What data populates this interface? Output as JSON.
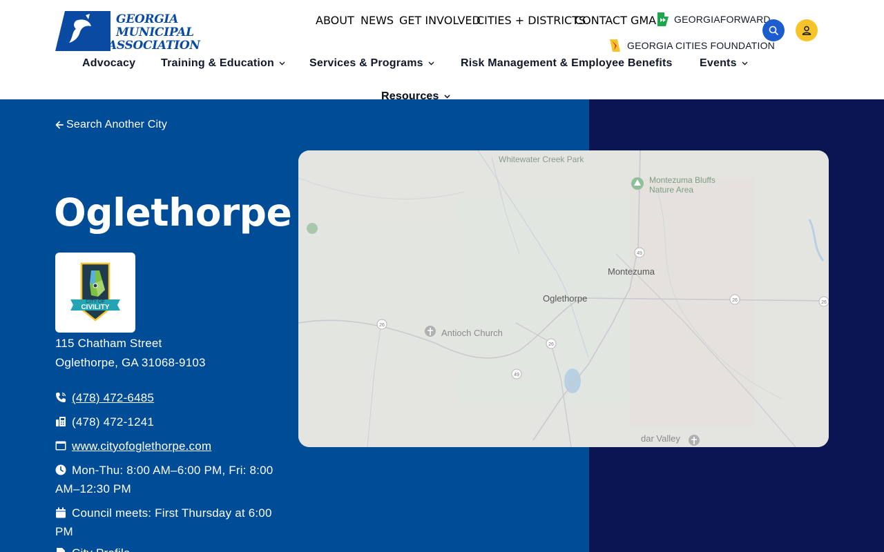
{
  "header": {
    "logo": {
      "line1": "GEORGIA",
      "line2": "MUNICIPAL",
      "line3": "ASSOCIATION"
    },
    "top_links": [
      "ABOUT",
      "NEWS",
      "GET INVOLVED",
      "CITIES + DISTRICTS",
      "CONTACT GMA"
    ],
    "georgia_forward": "GEORGIAFORWARD",
    "cities_foundation": "GEORGIA CITIES FOUNDATION",
    "search_icon": "search-icon",
    "user_icon": "user-icon",
    "main_nav": [
      {
        "label": "Advocacy",
        "dropdown": false
      },
      {
        "label": "Training & Education",
        "dropdown": true
      },
      {
        "label": "Services & Programs",
        "dropdown": true
      },
      {
        "label": "Risk Management & Employee Benefits",
        "dropdown": false
      },
      {
        "label": "Events",
        "dropdown": true
      },
      {
        "label": "Resources",
        "dropdown": true
      }
    ]
  },
  "hero": {
    "back_link": "Search Another City",
    "city_name": "Oglethorpe",
    "badge": {
      "line1": "CITY OF",
      "line2": "CIVILITY"
    },
    "address_line1": "115 Chatham Street",
    "address_line2": "Oglethorpe, GA 31068-9103",
    "phone": "(478) 472-6485",
    "fax": "(478) 472-1241",
    "website": "www.cityofoglethorpe.com",
    "hours": "Mon-Thu: 8:00 AM–6:00 PM, Fri: 8:00 AM–12:30 PM",
    "council": "Council meets: First Thursday at 6:00 PM",
    "profile": "City Profile"
  },
  "map": {
    "labels": {
      "park": "Whitewater Creek Park",
      "bluffs1": "Montezuma Bluffs",
      "bluffs2": "Nature Area",
      "montezuma": "Montezuma",
      "oglethorpe": "Oglethorpe",
      "church": "Antioch Church",
      "cedar": "dar Valley"
    },
    "shields": {
      "r49a": "49",
      "r26a": "26",
      "r26b": "26",
      "r26c": "26",
      "r49b": "49",
      "r26d": "26"
    }
  },
  "colors": {
    "primary_blue": "#004c97",
    "navy": "#0b1551",
    "search_blue": "#1d5ccf",
    "user_yellow": "#f6c42a"
  }
}
